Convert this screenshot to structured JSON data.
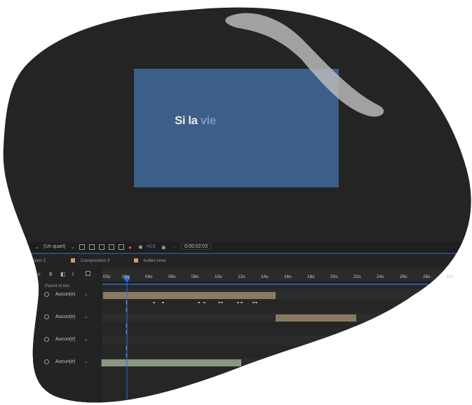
{
  "colors": {
    "panel_bg": "#242424",
    "composition_bg": "#3b5f88",
    "accent_blue": "#2d6fd8",
    "highlight": "#bdbdbd",
    "track_bar": "#8a7a64",
    "track_bar_green": "#8a9680",
    "swatch_tan": "#c9a267"
  },
  "composition": {
    "title_text_main": "Si la",
    "title_text_faded": "vie"
  },
  "viewer_toolbar": {
    "zoom_select": "(Un quart)",
    "exposure_value": "+0,0",
    "timecode": "0:00:02:03"
  },
  "tabs": [
    {
      "label": "ition 2"
    },
    {
      "label": "Composition 3"
    },
    {
      "label": "bulles reve"
    }
  ],
  "timeline": {
    "column_header": "Parent et lien",
    "ruler_labels": [
      "00s",
      "02s",
      "04s",
      "06s",
      "08s",
      "10s",
      "12s",
      "14s",
      "16s",
      "18s",
      "20s",
      "22s",
      "24s",
      "26s",
      "28s",
      "30s"
    ],
    "layers": [
      {
        "parent": "Aucun(e)"
      },
      {
        "parent": "Aucun(e)"
      },
      {
        "parent": "Aucun(e)"
      },
      {
        "parent": "Aucun(e)"
      }
    ]
  }
}
